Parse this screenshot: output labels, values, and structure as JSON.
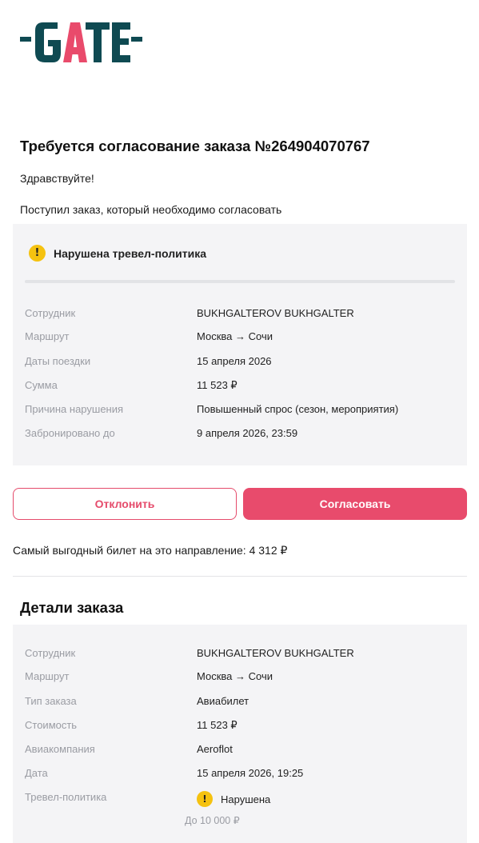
{
  "brand": {
    "name": "GATE",
    "dark_color": "#0f4a52",
    "accent_color": "#e94a6b"
  },
  "email": {
    "title": "Требуется согласование заказа №264904070767",
    "greeting": "Здравствуйте!",
    "lead": "Поступил заказ, который необходимо согласовать"
  },
  "violation": {
    "icon": "warning-icon",
    "heading": "Нарушена тревел-политика",
    "rows": [
      {
        "label": "Сотрудник",
        "value": "BUKHGALTEROV BUKHGALTER"
      },
      {
        "label": "Маршрут",
        "value": "Москва → Сочи"
      },
      {
        "label": "Даты поездки",
        "value": "15 апреля 2026"
      },
      {
        "label": "Сумма",
        "value": "11 523 ₽"
      },
      {
        "label": "Причина нарушения",
        "value": "Повышенный спрос (сезон, мероприятия)"
      },
      {
        "label": "Забронировано до",
        "value": "9 апреля 2026, 23:59"
      }
    ]
  },
  "actions": {
    "reject_label": "Отклонить",
    "approve_label": "Согласовать"
  },
  "cheapest": "Самый выгодный билет на это направление: 4 312 ₽",
  "details": {
    "title": "Детали заказа",
    "rows": [
      {
        "label": "Сотрудник",
        "value": "BUKHGALTEROV BUKHGALTER"
      },
      {
        "label": "Маршрут",
        "value": "Москва → Сочи"
      },
      {
        "label": "Тип заказа",
        "value": "Авиабилет"
      },
      {
        "label": "Стоимость",
        "value": "11 523 ₽"
      },
      {
        "label": "Авиакомпания",
        "value": "Aeroflot"
      },
      {
        "label": "Дата",
        "value": "15 апреля 2026, 19:25"
      }
    ],
    "policy": {
      "label": "Тревел-политика",
      "status": "Нарушена",
      "limit": "До 10 000 ₽"
    }
  }
}
